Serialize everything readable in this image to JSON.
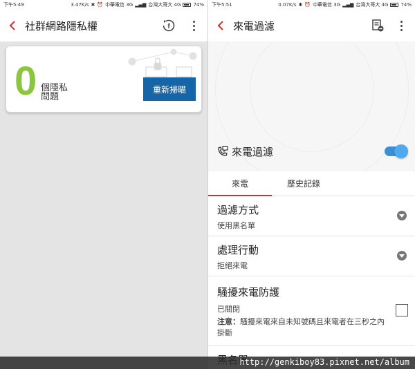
{
  "left": {
    "status": {
      "time": "下午5:49",
      "speed": "3.47K/s",
      "carrier1": "中華電信 3G",
      "carrier2": "台灣大哥大 4G",
      "battery": "74%"
    },
    "title": "社群網路隱私權",
    "card": {
      "count": "0",
      "label": "個隱私問題",
      "rescan": "重新掃瞄"
    }
  },
  "right": {
    "status": {
      "time": "下午5:51",
      "speed": "0.07K/s",
      "carrier1": "中華電信 3G",
      "carrier2": "台灣大哥大 4G",
      "battery": "74%"
    },
    "title": "來電過濾",
    "filter_label": "來電過濾",
    "filter_enabled": true,
    "tabs": [
      "來電",
      "歷史記錄"
    ],
    "rows": [
      {
        "title": "過濾方式",
        "value": "使用黑名單"
      },
      {
        "title": "處理行動",
        "value": "拒絕來電"
      },
      {
        "title": "騷擾來電防護",
        "value": "已關閉",
        "note_label": "注意：",
        "note": "騷擾來電來自未知號碼且來電者在三秒之內掛斷"
      },
      {
        "title": "黑名單"
      }
    ]
  },
  "watermark": "http://genkiboy83.pixnet.net/album",
  "colors": {
    "accent_red": "#d32f2f",
    "zero_green": "#8cc63f",
    "button_blue": "#1565a8",
    "toggle_blue": "#4fa9ef"
  }
}
